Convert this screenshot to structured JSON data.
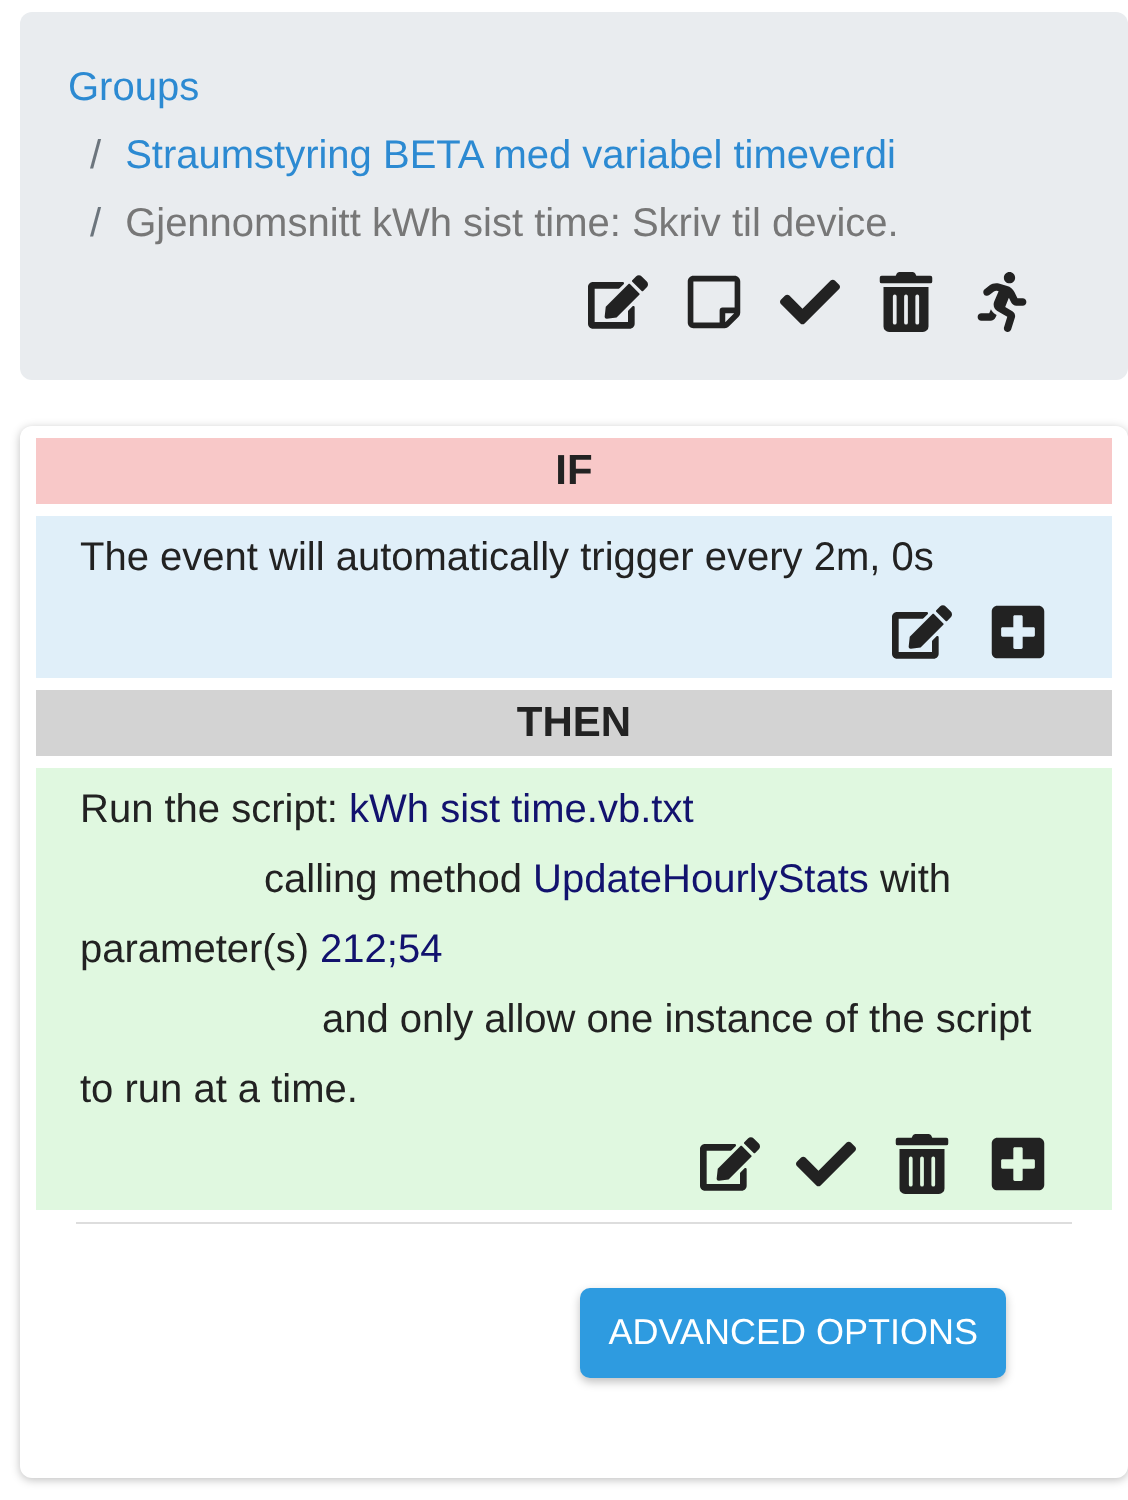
{
  "breadcrumb": {
    "items": [
      {
        "text": "Groups",
        "kind": "link"
      },
      {
        "separator": "/",
        "text": "Straumstyring BETA med variabel timeverdi",
        "kind": "link"
      },
      {
        "separator": "/",
        "text": "Gjennomsnitt kWh sist time: Skriv til device.",
        "kind": "current"
      }
    ],
    "actions": [
      {
        "kind": "edit"
      },
      {
        "kind": "note"
      },
      {
        "kind": "check"
      },
      {
        "kind": "delete"
      },
      {
        "kind": "run"
      }
    ]
  },
  "sections": [
    {
      "kind": "if",
      "header": "IF",
      "clauses": [
        [
          {
            "kind": "text",
            "text": "The event will automatically trigger every 2m, 0s"
          }
        ]
      ],
      "actions": [
        {
          "kind": "edit"
        },
        {
          "kind": "add"
        }
      ]
    },
    {
      "kind": "then",
      "header": "THEN",
      "clauses": [
        [
          {
            "kind": "text",
            "text": "Run the script: "
          },
          {
            "kind": "value",
            "text": "kWh sist time.vb.txt"
          }
        ],
        [
          {
            "kind": "text",
            "text": "calling method "
          },
          {
            "kind": "value",
            "text": "UpdateHourlyStats"
          },
          {
            "kind": "text",
            "text": " with parameter(s) "
          },
          {
            "kind": "value",
            "text": "212;54"
          }
        ],
        [
          {
            "kind": "text",
            "text": "and only allow one instance of the script to run at a time."
          }
        ]
      ],
      "actions": [
        {
          "kind": "edit"
        },
        {
          "kind": "check"
        },
        {
          "kind": "delete"
        },
        {
          "kind": "add"
        }
      ]
    }
  ],
  "button": "ADVANCED OPTIONS"
}
